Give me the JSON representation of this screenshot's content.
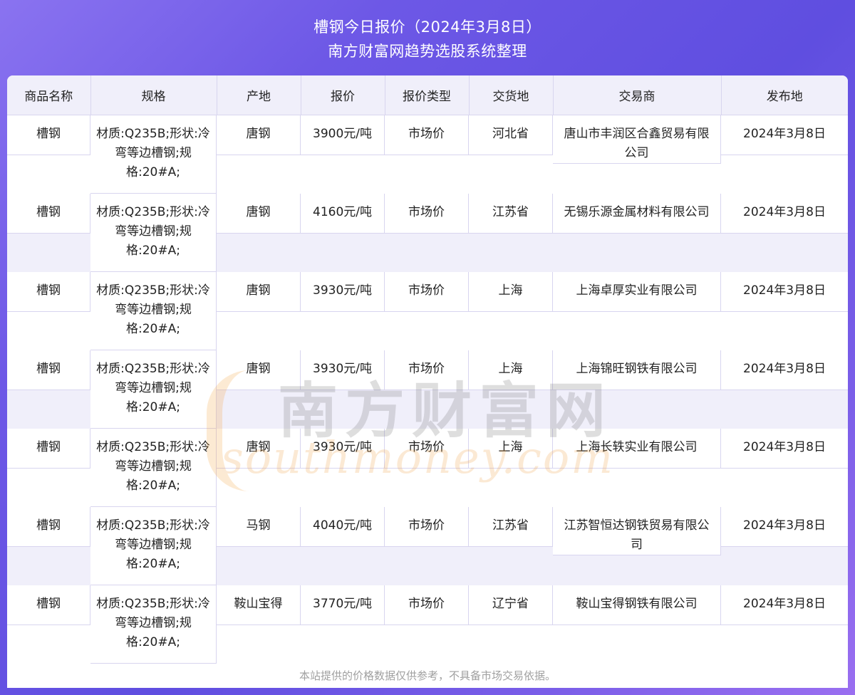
{
  "header": {
    "title": "槽钢今日报价（2024年3月8日）",
    "subtitle": "南方财富网趋势选股系统整理"
  },
  "table": {
    "columns": [
      "商品名称",
      "规格",
      "产地",
      "报价",
      "报价类型",
      "交货地",
      "交易商",
      "发布地"
    ],
    "rows": [
      {
        "name": "槽钢",
        "spec": "材质:Q235B;形状:冷弯等边槽钢;规格:20#A;",
        "origin": "唐钢",
        "price": "3900元/吨",
        "price_type": "市场价",
        "delivery": "河北省",
        "trader": "唐山市丰润区合鑫贸易有限公司",
        "date": "2024年3月8日"
      },
      {
        "name": "槽钢",
        "spec": "材质:Q235B;形状:冷弯等边槽钢;规格:20#A;",
        "origin": "唐钢",
        "price": "4160元/吨",
        "price_type": "市场价",
        "delivery": "江苏省",
        "trader": "无锡乐源金属材料有限公司",
        "date": "2024年3月8日"
      },
      {
        "name": "槽钢",
        "spec": "材质:Q235B;形状:冷弯等边槽钢;规格:20#A;",
        "origin": "唐钢",
        "price": "3930元/吨",
        "price_type": "市场价",
        "delivery": "上海",
        "trader": "上海卓厚实业有限公司",
        "date": "2024年3月8日"
      },
      {
        "name": "槽钢",
        "spec": "材质:Q235B;形状:冷弯等边槽钢;规格:20#A;",
        "origin": "唐钢",
        "price": "3930元/吨",
        "price_type": "市场价",
        "delivery": "上海",
        "trader": "上海锦旺钢铁有限公司",
        "date": "2024年3月8日"
      },
      {
        "name": "槽钢",
        "spec": "材质:Q235B;形状:冷弯等边槽钢;规格:20#A;",
        "origin": "唐钢",
        "price": "3930元/吨",
        "price_type": "市场价",
        "delivery": "上海",
        "trader": "上海长轶实业有限公司",
        "date": "2024年3月8日"
      },
      {
        "name": "槽钢",
        "spec": "材质:Q235B;形状:冷弯等边槽钢;规格:20#A;",
        "origin": "马钢",
        "price": "4040元/吨",
        "price_type": "市场价",
        "delivery": "江苏省",
        "trader": "江苏智恒达钢铁贸易有限公司",
        "date": "2024年3月8日"
      },
      {
        "name": "槽钢",
        "spec": "材质:Q235B;形状:冷弯等边槽钢;规格:20#A;",
        "origin": "鞍山宝得",
        "price": "3770元/吨",
        "price_type": "市场价",
        "delivery": "辽宁省",
        "trader": "鞍山宝得钢铁有限公司",
        "date": "2024年3月8日"
      }
    ]
  },
  "watermark": {
    "cn": "南方财富网",
    "en": "southmoney.com"
  },
  "footer": {
    "disclaimer": "本站提供的价格数据仅供参考，不具备市场交易依据。"
  }
}
